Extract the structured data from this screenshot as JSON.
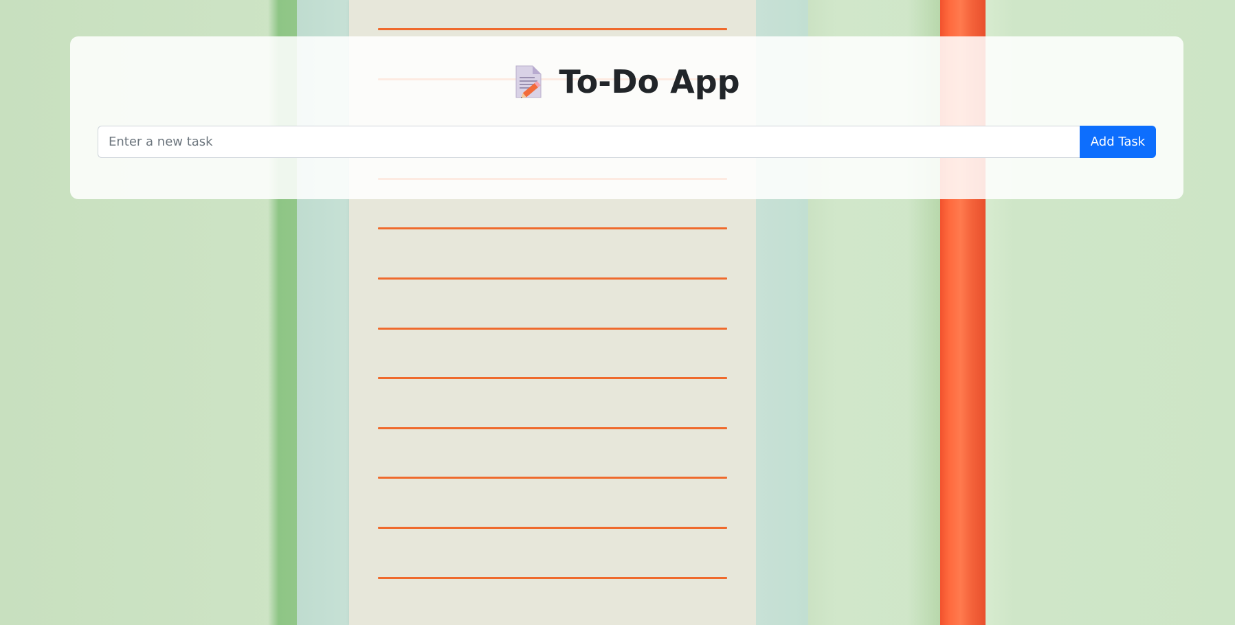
{
  "app": {
    "title": "To-Do App",
    "title_icon": "memo-icon"
  },
  "task_entry": {
    "placeholder": "Enter a new task",
    "value": "",
    "add_button_label": "Add Task"
  },
  "colors": {
    "accent": "#0d6efd",
    "title_text": "#212529",
    "background_green": "#cfe5c8",
    "paper_lines": "#ef6a2c",
    "pencil": "#ff6a3e"
  }
}
